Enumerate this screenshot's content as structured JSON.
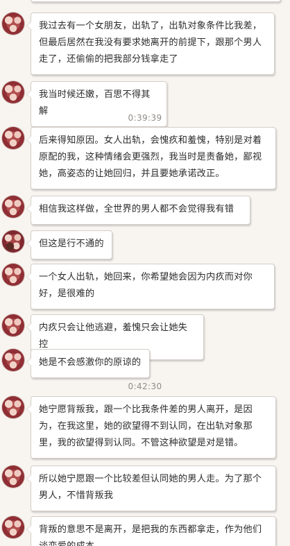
{
  "chat": {
    "timestamps": [
      "0:39:39",
      "0:42:30"
    ],
    "messages": [
      {
        "text": "我过去有一个女朋友，出轨了，出轨对象条件比我差，但最后居然在我没有要求她离开的前提下，跟那个男人走了，还偷偷的把我部分钱拿走了"
      },
      {
        "text": "我当时候还嫩，百思不得其解"
      },
      {
        "text": "后来得知原因。女人出轨，会愧疚和羞愧，特别是对着原配的我，这种情绪会更强烈，我当时是责备她，鄙视她，高姿态的让她回归，并且要她承诺改正。"
      },
      {
        "text": "相信我这样做，全世界的男人都不会觉得我有错"
      },
      {
        "text": "但这是行不通的"
      },
      {
        "text": "一个女人出轨，她回来，你希望她会因为内疚而对你好，是很难的"
      },
      {
        "text": "内疚只会让他逃避，羞愧只会让她失控"
      },
      {
        "text": "她是不会感激你的原谅的"
      },
      {
        "text": "她宁愿背叛我，跟一个比我条件差的男人离开，是因为，在我这里，她的欲望得不到认同，在出轨对象那里，我的欲望得到认同。不管这种欲望是对是错。"
      },
      {
        "text": "所以她宁愿跟一个比较差但认同她的男人走。为了那个男人，不惜背叛我"
      },
      {
        "text": "背叛的意思不是离开，是把我的东西都拿走，作为他们谈恋爱的成本"
      }
    ]
  }
}
